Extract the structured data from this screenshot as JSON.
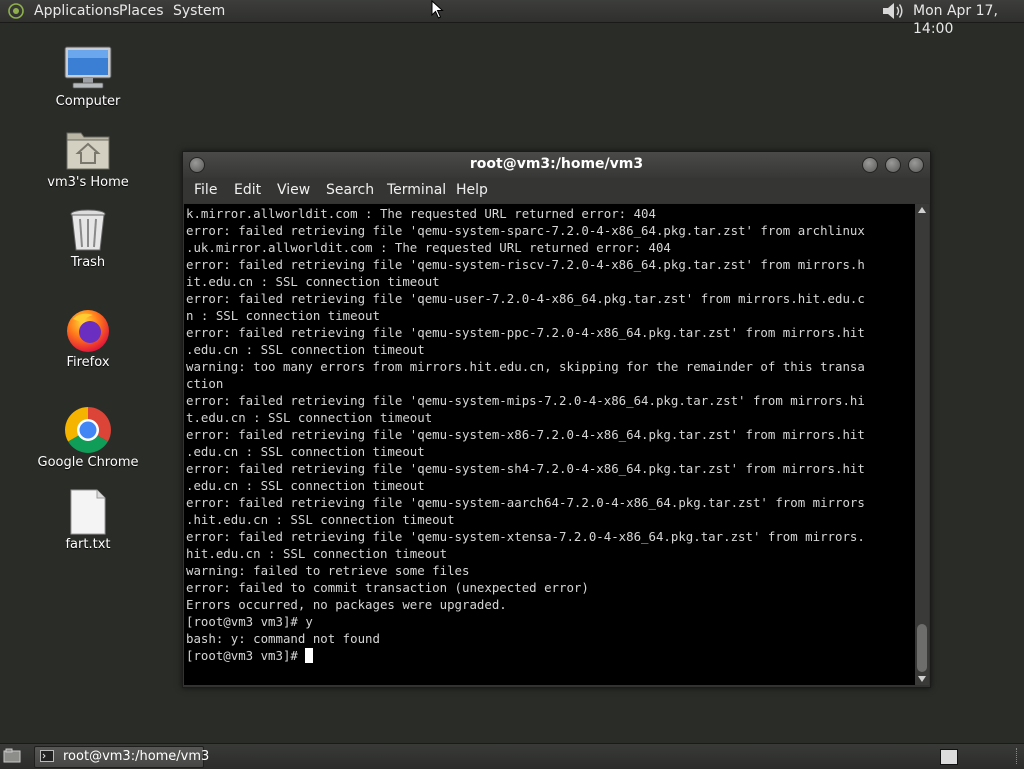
{
  "top_panel": {
    "menus": [
      "Applications",
      "Places",
      "System"
    ],
    "clock": "Mon Apr 17, 14:00"
  },
  "desktop_icons": [
    {
      "label": "Computer",
      "icon": "computer-icon"
    },
    {
      "label": "vm3's Home",
      "icon": "home-folder-icon"
    },
    {
      "label": "Trash",
      "icon": "trash-icon"
    },
    {
      "label": "Firefox",
      "icon": "firefox-icon"
    },
    {
      "label": "Google Chrome",
      "icon": "chrome-icon"
    },
    {
      "label": "fart.txt",
      "icon": "text-file-icon"
    }
  ],
  "terminal": {
    "title": "root@vm3:/home/vm3",
    "menu": [
      "File",
      "Edit",
      "View",
      "Search",
      "Terminal",
      "Help"
    ],
    "lines": [
      "k.mirror.allworldit.com : The requested URL returned error: 404",
      "error: failed retrieving file 'qemu-system-sparc-7.2.0-4-x86_64.pkg.tar.zst' from archlinux",
      ".uk.mirror.allworldit.com : The requested URL returned error: 404",
      "error: failed retrieving file 'qemu-system-riscv-7.2.0-4-x86_64.pkg.tar.zst' from mirrors.h",
      "it.edu.cn : SSL connection timeout",
      "error: failed retrieving file 'qemu-user-7.2.0-4-x86_64.pkg.tar.zst' from mirrors.hit.edu.c",
      "n : SSL connection timeout",
      "error: failed retrieving file 'qemu-system-ppc-7.2.0-4-x86_64.pkg.tar.zst' from mirrors.hit",
      ".edu.cn : SSL connection timeout",
      "warning: too many errors from mirrors.hit.edu.cn, skipping for the remainder of this transa",
      "ction",
      "error: failed retrieving file 'qemu-system-mips-7.2.0-4-x86_64.pkg.tar.zst' from mirrors.hi",
      "t.edu.cn : SSL connection timeout",
      "error: failed retrieving file 'qemu-system-x86-7.2.0-4-x86_64.pkg.tar.zst' from mirrors.hit",
      ".edu.cn : SSL connection timeout",
      "error: failed retrieving file 'qemu-system-sh4-7.2.0-4-x86_64.pkg.tar.zst' from mirrors.hit",
      ".edu.cn : SSL connection timeout",
      "error: failed retrieving file 'qemu-system-aarch64-7.2.0-4-x86_64.pkg.tar.zst' from mirrors",
      ".hit.edu.cn : SSL connection timeout",
      "error: failed retrieving file 'qemu-system-xtensa-7.2.0-4-x86_64.pkg.tar.zst' from mirrors.",
      "hit.edu.cn : SSL connection timeout",
      "warning: failed to retrieve some files",
      "error: failed to commit transaction (unexpected error)",
      "Errors occurred, no packages were upgraded.",
      "[root@vm3 vm3]# y",
      "bash: y: command not found",
      "[root@vm3 vm3]# "
    ],
    "prompt": "[root@vm3 vm3]# "
  },
  "bottom_panel": {
    "task": "root@vm3:/home/vm3"
  }
}
